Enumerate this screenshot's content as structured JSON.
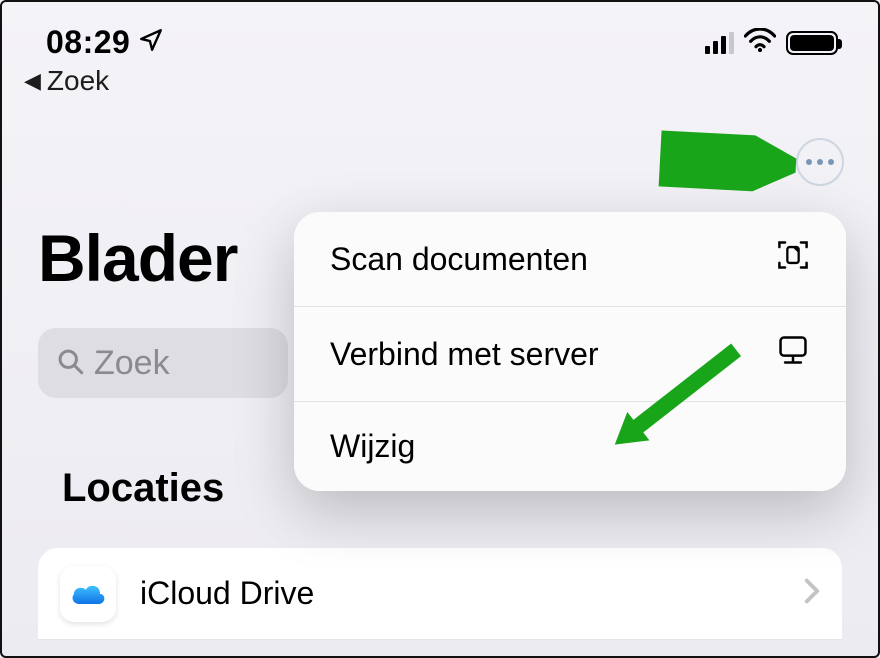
{
  "status": {
    "time": "08:29",
    "icons": {
      "location": "location-icon",
      "signal": "cellular-icon",
      "wifi": "wifi-icon",
      "battery": "battery-icon"
    }
  },
  "back": {
    "label": "Zoek"
  },
  "page": {
    "title": "Blader"
  },
  "search": {
    "placeholder": "Zoek"
  },
  "section": {
    "title": "Locaties"
  },
  "locations": {
    "items": [
      {
        "label": "iCloud Drive"
      }
    ]
  },
  "menu": {
    "items": [
      {
        "label": "Scan documenten"
      },
      {
        "label": "Verbind met server"
      },
      {
        "label": "Wijzig"
      }
    ]
  },
  "annotation": {
    "color": "#1aa51a"
  }
}
